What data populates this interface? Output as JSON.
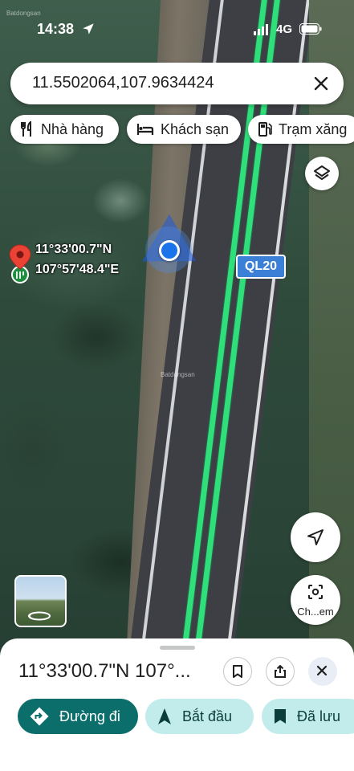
{
  "status_bar": {
    "time": "14:38",
    "network": "4G"
  },
  "search": {
    "value": "11.5502064,107.9634424"
  },
  "chips": [
    {
      "label": "Nhà hàng",
      "icon": "restaurant-icon"
    },
    {
      "label": "Khách sạn",
      "icon": "hotel-icon"
    },
    {
      "label": "Trạm xăng",
      "icon": "gas-station-icon"
    }
  ],
  "map": {
    "pin_lat": "11°33'00.7\"N",
    "pin_lng": "107°57'48.4\"E",
    "road_label": "QL20",
    "lens_label": "Ch...em",
    "watermark": "Batdongsan"
  },
  "sheet": {
    "title": "11°33'00.7\"N 107°...",
    "actions": {
      "directions": "Đường đi",
      "start": "Bắt đầu",
      "saved": "Đã lưu"
    }
  },
  "colors": {
    "route": "#2fe07a",
    "accent": "#0b6e6b",
    "tonal": "#c2ecec",
    "location": "#1a73e8",
    "pin": "#ea4335"
  }
}
